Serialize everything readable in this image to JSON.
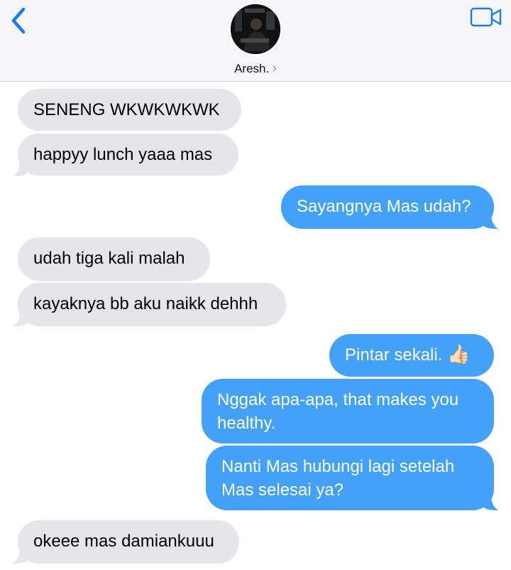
{
  "header": {
    "contact_name": "Aresh.",
    "chevron": "›",
    "back_icon": "chevron-left-icon",
    "video_icon": "video-camera-icon",
    "accent_color": "#1a7cf5"
  },
  "messages": [
    {
      "from": "them",
      "text": "SENENG WKWKWKWK"
    },
    {
      "from": "them",
      "text": "happyy lunch yaaa mas"
    },
    {
      "from": "me",
      "text": "Sayangnya Mas udah?"
    },
    {
      "from": "them",
      "text": "udah tiga kali malah"
    },
    {
      "from": "them",
      "text": "kayaknya bb aku naikk dehhh"
    },
    {
      "from": "me",
      "text": "Pintar sekali.",
      "emoji": "👍🏻"
    },
    {
      "from": "me",
      "text": "Nggak apa-apa, that makes you healthy."
    },
    {
      "from": "me",
      "text": "Nanti Mas hubungi lagi setelah Mas selesai ya?"
    },
    {
      "from": "them",
      "text": "okeee mas damiankuuu"
    }
  ],
  "colors": {
    "sent_bubble": "#43a1f7",
    "received_bubble": "#e5e5ea",
    "header_bg": "#f6f6f8"
  }
}
